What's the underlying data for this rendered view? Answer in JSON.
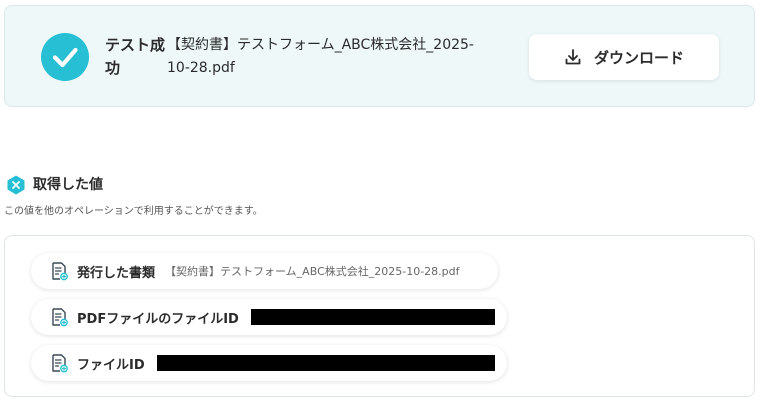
{
  "result": {
    "status": "テスト成功",
    "file_name": "【契約書】テストフォーム_ABC株式会社_2025-10-28.pdf",
    "download_label": "ダウンロード"
  },
  "obtained_values": {
    "title": "取得した値",
    "description": "この値を他のオペレーションで利用することができます。",
    "items": [
      {
        "label": "発行した書類",
        "value": "【契約書】テストフォーム_ABC株式会社_2025-10-28.pdf"
      },
      {
        "label": "PDFファイルのファイルID",
        "value": ""
      },
      {
        "label": "ファイルID",
        "value": ""
      }
    ]
  },
  "colors": {
    "success_accent": "#26bfd3",
    "card_background": "#eef8f9"
  }
}
